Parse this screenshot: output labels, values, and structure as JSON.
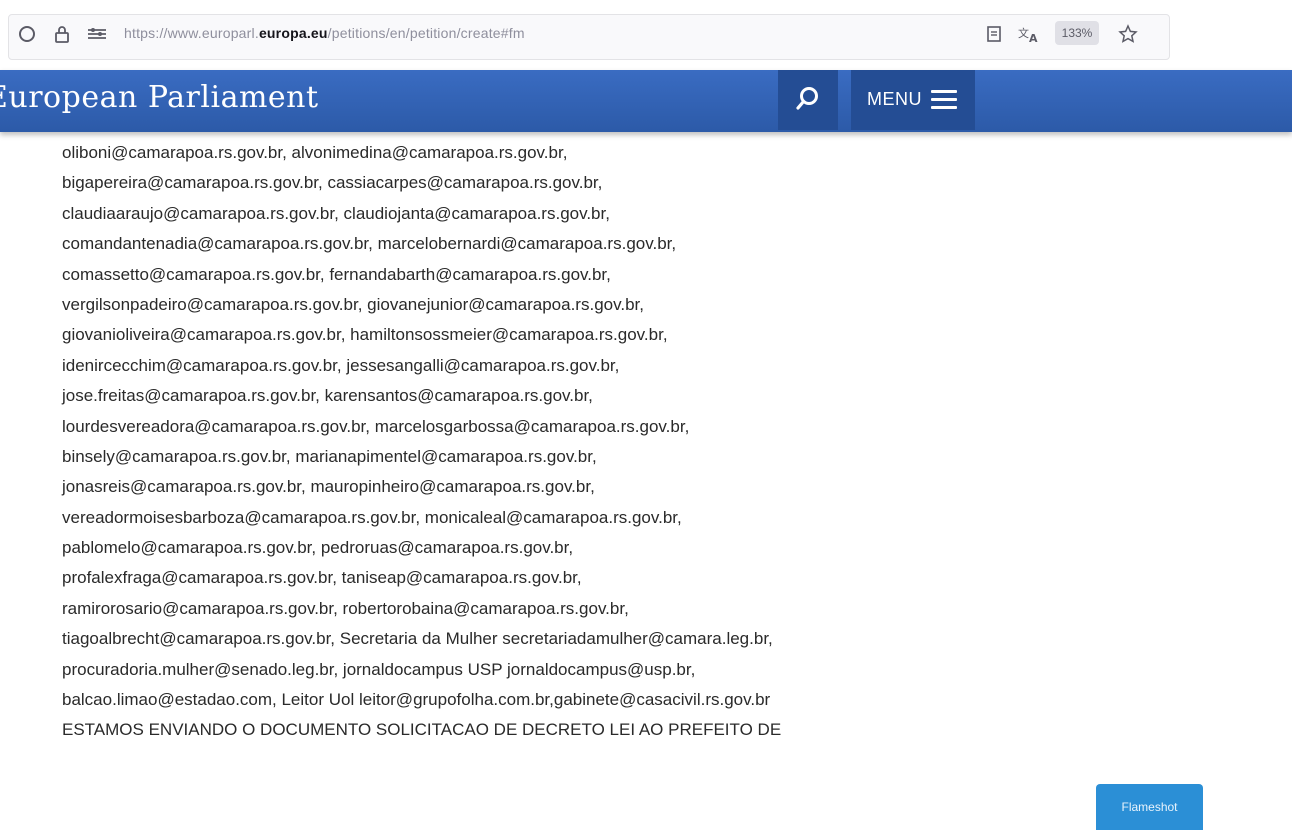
{
  "browser": {
    "url_prefix": "https://www.europarl.",
    "url_domain": "europa.eu",
    "url_suffix": "/petitions/en/petition/create#fm",
    "zoom": "133%"
  },
  "header": {
    "title": "European Parliament",
    "menu_label": "MENU"
  },
  "content": {
    "lines": [
      "oliboni@camarapoa.rs.gov.br, alvonimedina@camarapoa.rs.gov.br,",
      "bigapereira@camarapoa.rs.gov.br, cassiacarpes@camarapoa.rs.gov.br,",
      "claudiaaraujo@camarapoa.rs.gov.br, claudiojanta@camarapoa.rs.gov.br,",
      "comandantenadia@camarapoa.rs.gov.br, marcelobernardi@camarapoa.rs.gov.br,",
      "comassetto@camarapoa.rs.gov.br, fernandabarth@camarapoa.rs.gov.br,",
      "vergilsonpadeiro@camarapoa.rs.gov.br, giovanejunior@camarapoa.rs.gov.br,",
      "giovanioliveira@camarapoa.rs.gov.br, hamiltonsossmeier@camarapoa.rs.gov.br,",
      "idenircecchim@camarapoa.rs.gov.br, jessesangalli@camarapoa.rs.gov.br,",
      "jose.freitas@camarapoa.rs.gov.br, karensantos@camarapoa.rs.gov.br,",
      "lourdesvereadora@camarapoa.rs.gov.br, marcelosgarbossa@camarapoa.rs.gov.br,",
      "binsely@camarapoa.rs.gov.br, marianapimentel@camarapoa.rs.gov.br,",
      "jonasreis@camarapoa.rs.gov.br, mauropinheiro@camarapoa.rs.gov.br,",
      "vereadormoisesbarboza@camarapoa.rs.gov.br, monicaleal@camarapoa.rs.gov.br,",
      "pablomelo@camarapoa.rs.gov.br, pedroruas@camarapoa.rs.gov.br,",
      "profalexfraga@camarapoa.rs.gov.br, taniseap@camarapoa.rs.gov.br,",
      "ramirorosario@camarapoa.rs.gov.br, robertorobaina@camarapoa.rs.gov.br,",
      "tiagoalbrecht@camarapoa.rs.gov.br, Secretaria da Mulher secretariadamulher@camara.leg.br,",
      "procuradoria.mulher@senado.leg.br, jornaldocampus USP jornaldocampus@usp.br,",
      "balcao.limao@estadao.com, Leitor Uol leitor@grupofolha.com.br,gabinete@casacivil.rs.gov.br",
      "ESTAMOS ENVIANDO O DOCUMENTO SOLICITACAO DE DECRETO LEI AO PREFEITO DE"
    ]
  },
  "overlay": {
    "flameshot_label": "Flameshot"
  }
}
